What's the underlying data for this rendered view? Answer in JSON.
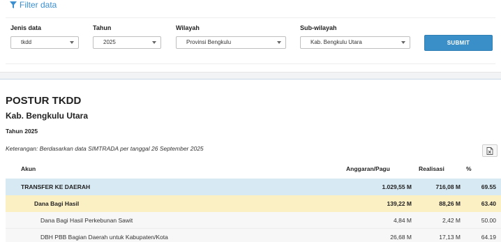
{
  "filter": {
    "title": "Filter data",
    "fields": [
      {
        "label": "Jenis data",
        "value": "tkdd"
      },
      {
        "label": "Tahun",
        "value": "2025"
      },
      {
        "label": "Wilayah",
        "value": "Provinsi Bengkulu"
      },
      {
        "label": "Sub-wilayah",
        "value": "Kab. Bengkulu Utara"
      }
    ],
    "submit_label": "SUBMIT"
  },
  "report": {
    "title": "POSTUR TKDD",
    "region": "Kab. Bengkulu Utara",
    "year": "Tahun 2025",
    "note": "Keterangan: Berdasarkan data SIMTRADA per tanggal 26 September 2025",
    "export_icon": "excel-export-icon",
    "columns": {
      "akun": "Akun",
      "pagu": "Anggaran/Pagu",
      "realisasi": "Realisasi",
      "persen": "%"
    },
    "rows": [
      {
        "akun": "TRANSFER KE DAERAH",
        "pagu": "1.029,55 M",
        "realisasi": "716,08 M",
        "persen": "69.55"
      },
      {
        "akun": "Dana Bagi Hasil",
        "pagu": "139,22 M",
        "realisasi": "88,26 M",
        "persen": "63.40"
      },
      {
        "akun": "Dana Bagi Hasil Perkebunan Sawit",
        "pagu": "4,84 M",
        "realisasi": "2,42 M",
        "persen": "50.00"
      },
      {
        "akun": "DBH PBB Bagian Daerah untuk Kabupaten/Kota",
        "pagu": "26,68 M",
        "realisasi": "17,13 M",
        "persen": "64.19"
      }
    ]
  },
  "colors": {
    "accent": "#3a8fc8",
    "level0_bg": "#d7e9f3",
    "level1_bg": "#fbefc4",
    "level2_bg": "#f7f7f7"
  }
}
